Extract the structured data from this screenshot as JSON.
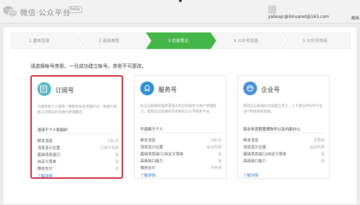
{
  "header": {
    "app_title": "微信·公众平台",
    "beta_badge": "beta",
    "account_email": "yaboajc@ilmuanet@163.com",
    "logout_label": "退出"
  },
  "steps": [
    {
      "label": "1 基本信息",
      "active": false
    },
    {
      "label": "2 选择类型",
      "active": false
    },
    {
      "label": "3 信息登记",
      "active": true
    },
    {
      "label": "4 公众号信息",
      "active": false
    },
    {
      "label": "5 公众号审核",
      "active": false
    }
  ],
  "instruction": "请选择帐号类型，一旦成功建立帐号，类型不可更改。",
  "cards": [
    {
      "title": "订阅号",
      "icon": "subscription-icon",
      "color": "#5ab8c6",
      "description": "为媒体和个人提供一种新的信息传播方式，构建与读者之间更好的沟通与管理模式。",
      "suitable": "适用于个人和组织",
      "features": [
        {
          "name": "群发消息",
          "value": "1条/天"
        },
        {
          "name": "消息显示位置",
          "value": "订阅号列表"
        },
        {
          "name": "基础消息接口",
          "value": "有"
        },
        {
          "name": "自定义菜单",
          "value": "有"
        },
        {
          "name": "微信支付",
          "value": "无"
        }
      ],
      "more": "了解详情"
    },
    {
      "title": "服务号",
      "icon": "service-icon",
      "color": "#2f8fd0",
      "description": "给企业和组织提供更强大的业务服务与用户管理能力，帮助企业快速实现全新的公众号服务平台。",
      "suitable": "不适用于个人",
      "features": [
        {
          "name": "群发消息",
          "value": "4条/月"
        },
        {
          "name": "消息显示位置",
          "value": "会话列表"
        },
        {
          "name": "基础消息接口/自定义菜单",
          "value": "有"
        },
        {
          "name": "高级接口能力",
          "value": "有"
        },
        {
          "name": "微信支付",
          "value": "可申请"
        }
      ],
      "more": "了解详情"
    },
    {
      "title": "企业号",
      "icon": "enterprise-icon",
      "color": "#4a8fd6",
      "description": "帮助企业和组织内部建立员工、上下游合作伙伴与企业IT系统间的连接。",
      "suitable": "和业务流程管理软件以及内部办公",
      "features": [
        {
          "name": "群发消息",
          "value": "无限制"
        },
        {
          "name": "消息显示位置",
          "value": "会话列表"
        },
        {
          "name": "基础消息接口/自定义菜单",
          "value": "有"
        },
        {
          "name": "高级接口能力",
          "value": "有"
        }
      ],
      "more": "了解详情"
    }
  ]
}
